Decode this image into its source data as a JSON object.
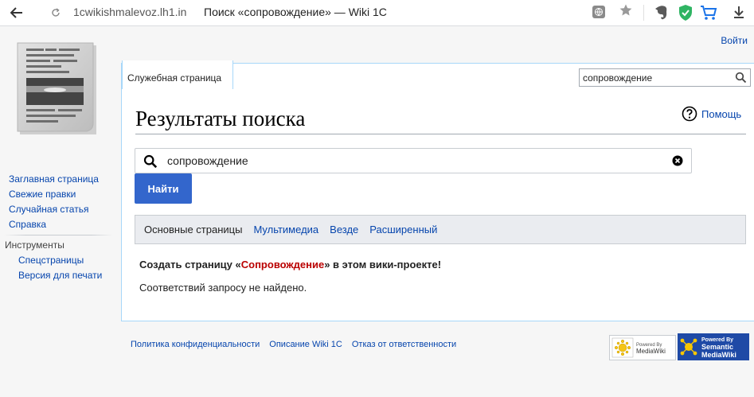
{
  "browser": {
    "url_domain": "1cwikishmalevoz.lh1.in",
    "tab_title": "Поиск «сопровождение» — Wiki 1C"
  },
  "personal": {
    "login": "Войти"
  },
  "sidebar": {
    "nav": [
      "Заглавная страница",
      "Свежие правки",
      "Случайная статья",
      "Справка"
    ],
    "tools_heading": "Инструменты",
    "tools": [
      "Спецстраницы",
      "Версия для печати"
    ]
  },
  "tabs": {
    "special": "Служебная страница"
  },
  "header_search": {
    "value": "сопровождение"
  },
  "content": {
    "title": "Результаты поиска",
    "help": "Помощь",
    "search_value": "сопровождение",
    "search_button": "Найти",
    "profiles": [
      "Основные страницы",
      "Мультимедиа",
      "Везде",
      "Расширенный"
    ],
    "create_prefix": "Создать страницу «",
    "create_term": "Сопровождение",
    "create_suffix": "» в этом вики-проекте!",
    "no_results": "Соответствий запросу не найдено."
  },
  "footer": {
    "links": [
      "Политика конфиденциальности",
      "Описание Wiki 1C",
      "Отказ от ответственности"
    ],
    "badge_mw_line1": "Powered By",
    "badge_mw_line2": "MediaWiki",
    "badge_smw_line1": "Powered By",
    "badge_smw_line2": "Semantic",
    "badge_smw_line3": "MediaWiki"
  },
  "colors": {
    "link": "#0645ad",
    "button": "#3366cc",
    "new_link": "#ba0000"
  }
}
